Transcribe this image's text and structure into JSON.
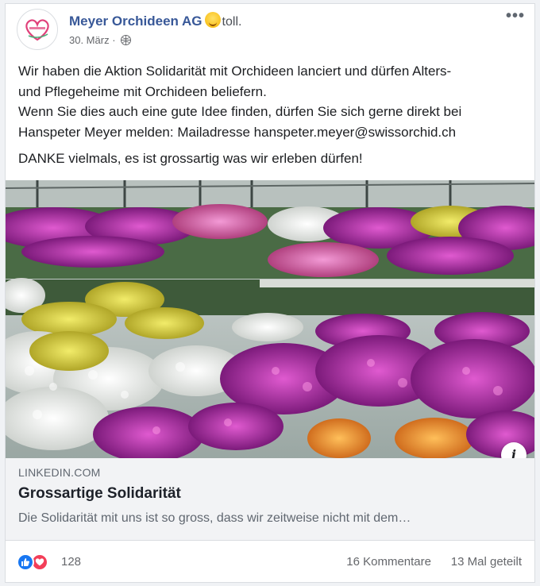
{
  "post": {
    "page_name": "Meyer Orchideen AG",
    "feeling": "toll.",
    "date": "30. März",
    "separator": "·",
    "text_paragraph_1_line_1": "Wir haben die Aktion Solidarität mit Orchideen lanciert und dürfen Alters-",
    "text_paragraph_1_line_2": "und Pflegeheime mit Orchideen beliefern.",
    "text_paragraph_1_line_3": "Wenn Sie dies auch eine gute Idee finden, dürfen Sie sich gerne direkt bei",
    "text_paragraph_1_line_4": "Hanspeter Meyer melden: Mailadresse hanspeter.meyer@swissorchid.ch",
    "text_paragraph_2": "DANKE vielmals, es ist grossartig was wir erleben dürfen!"
  },
  "link_preview": {
    "domain": "LINKEDIN.COM",
    "title": "Grossartige Solidarität",
    "description": "Die Solidarität mit uns ist so gross, dass wir zeitweise nicht mit dem…",
    "info_label": "i"
  },
  "stats": {
    "reaction_count": "128",
    "comments": "16 Kommentare",
    "shares": "13 Mal geteilt"
  },
  "icons": {
    "more": "more-options-icon",
    "privacy": "globe-icon",
    "like": "like-icon",
    "love": "love-icon",
    "feeling": "grinning-emoji-icon"
  },
  "colors": {
    "page_name": "#385898",
    "like": "#1877f2",
    "love": "#f33e58",
    "link_box_bg": "#f2f3f5"
  }
}
